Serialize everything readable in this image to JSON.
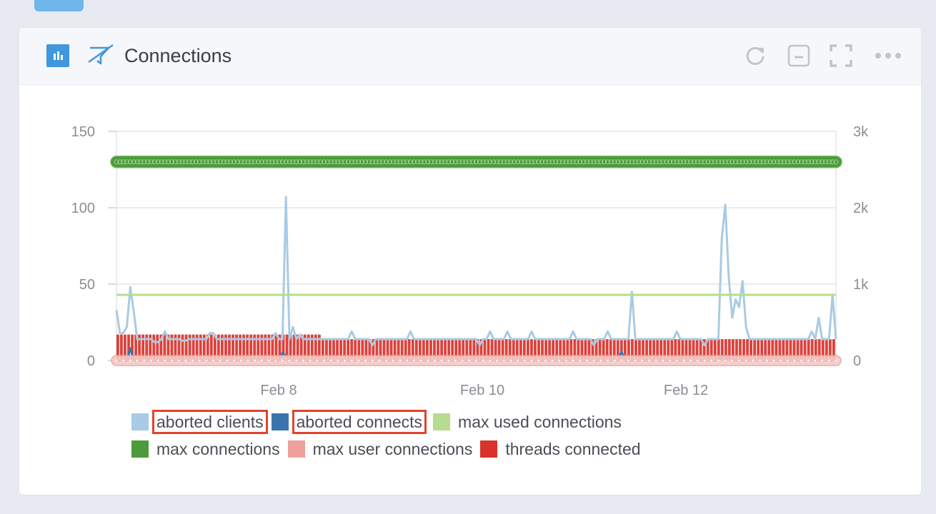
{
  "panel": {
    "title": "Connections",
    "icons": {
      "panel_type": "bar-chart-icon",
      "link": "unlink-icon",
      "refresh": "refresh-icon",
      "collapse": "minimize-icon",
      "fullscreen": "fullscreen-icon",
      "more": "more-options-icon"
    }
  },
  "chart_data": {
    "type": "line",
    "title": "Connections",
    "xlabel": "",
    "ylabel_left": "",
    "ylabel_right": "",
    "x_ticks": [
      "Feb 8",
      "Feb 10",
      "Feb 12"
    ],
    "y_left": {
      "range": [
        0,
        150
      ],
      "ticks": [
        "0",
        "50",
        "100",
        "150"
      ]
    },
    "y_right": {
      "range": [
        0,
        3000
      ],
      "ticks": [
        "0",
        "1k",
        "2k",
        "3k"
      ]
    },
    "grid": true,
    "legend_position": "bottom",
    "x_range_days": [
      "Feb 7 ~03:00",
      "Feb 13 ~13:00"
    ],
    "series": [
      {
        "name": "aborted clients",
        "type": "line",
        "axis": "left",
        "color": "#a9cbe3",
        "values": [
          33,
          18,
          18,
          22,
          48,
          32,
          14,
          14,
          14,
          14,
          14,
          12,
          12,
          14,
          19,
          14,
          14,
          14,
          14,
          13,
          13,
          14,
          14,
          14,
          14,
          14,
          14,
          18,
          18,
          14,
          14,
          14,
          14,
          14,
          14,
          14,
          14,
          14,
          14,
          14,
          14,
          14,
          14,
          14,
          14,
          14,
          18,
          14,
          14,
          107,
          14,
          22,
          14,
          17,
          14,
          14,
          14,
          14,
          14,
          14,
          14,
          14,
          14,
          14,
          14,
          14,
          14,
          14,
          19,
          14,
          14,
          14,
          14,
          14,
          10,
          14,
          14,
          14,
          14,
          14,
          14,
          14,
          14,
          14,
          14,
          19,
          14,
          14,
          14,
          14,
          14,
          14,
          14,
          14,
          14,
          14,
          14,
          14,
          14,
          14,
          14,
          14,
          14,
          14,
          14,
          10,
          14,
          14,
          19,
          14,
          14,
          14,
          14,
          19,
          14,
          14,
          14,
          14,
          14,
          14,
          19,
          14,
          14,
          14,
          14,
          14,
          14,
          14,
          14,
          14,
          14,
          14,
          19,
          14,
          14,
          14,
          14,
          14,
          10,
          14,
          14,
          14,
          19,
          14,
          14,
          14,
          14,
          14,
          14,
          45,
          14,
          14,
          14,
          14,
          14,
          14,
          14,
          14,
          14,
          14,
          14,
          14,
          19,
          14,
          14,
          14,
          14,
          14,
          14,
          14,
          10,
          14,
          14,
          14,
          14,
          80,
          102,
          55,
          28,
          40,
          35,
          52,
          22,
          14,
          14,
          14,
          14,
          14,
          14,
          14,
          14,
          14,
          14,
          14,
          14,
          14,
          14,
          14,
          14,
          14,
          14,
          19,
          14,
          28,
          14,
          14,
          14,
          43,
          14
        ]
      },
      {
        "name": "aborted connects",
        "type": "line",
        "axis": "left",
        "color": "#3a74ae",
        "values": [
          0,
          0,
          0,
          0,
          8,
          0,
          0,
          0,
          0,
          0,
          0,
          0,
          0,
          0,
          0,
          0,
          0,
          0,
          0,
          0,
          0,
          0,
          0,
          0,
          0,
          0,
          0,
          0,
          0,
          0,
          0,
          0,
          0,
          0,
          0,
          0,
          0,
          0,
          0,
          0,
          0,
          1,
          0,
          0,
          0,
          0,
          0,
          0,
          5,
          3,
          0,
          0,
          0,
          0,
          0,
          0,
          0,
          0,
          0,
          0,
          0,
          0,
          0,
          0,
          0,
          0,
          0,
          0,
          0,
          0,
          0,
          0,
          0,
          0,
          0,
          0,
          2,
          0,
          0,
          0,
          0,
          0,
          0,
          0,
          0,
          0,
          0,
          0,
          0,
          0,
          0,
          0,
          0,
          0,
          0,
          0,
          0,
          0,
          0,
          0,
          0,
          0,
          0,
          0,
          0,
          0,
          0,
          1,
          0,
          0,
          0,
          0,
          0,
          0,
          0,
          0,
          0,
          0,
          0,
          0,
          0,
          0,
          0,
          0,
          0,
          0,
          0,
          0,
          0,
          0,
          0,
          0,
          0,
          0,
          0,
          0,
          0,
          0,
          0,
          0,
          0,
          0,
          0,
          0,
          0,
          0,
          6,
          0,
          0,
          0,
          0,
          0,
          0,
          0,
          0,
          0,
          0,
          0,
          0,
          0,
          0,
          0,
          0,
          0,
          0,
          0,
          0,
          0,
          0,
          0,
          0,
          0,
          0,
          0,
          0,
          2,
          0,
          2,
          0,
          0,
          0,
          0,
          0,
          0,
          0,
          0,
          0,
          0,
          0,
          0,
          0,
          0,
          0,
          0,
          0,
          0,
          0,
          0,
          0,
          0,
          0,
          0,
          0,
          0,
          0,
          0,
          0,
          0
        ]
      },
      {
        "name": "max used connections",
        "type": "line",
        "axis": "left",
        "color": "#b6dc8e",
        "values_constant": 43
      },
      {
        "name": "max connections",
        "type": "line-markers",
        "axis": "right",
        "color": "#4b9a3b",
        "values_constant": 2600
      },
      {
        "name": "max user connections",
        "type": "line-markers",
        "axis": "right",
        "color": "#f0a09b",
        "values_constant": 0
      },
      {
        "name": "threads connected",
        "type": "bar",
        "axis": "left",
        "color": "#d8322b",
        "values_summary": {
          "first_quarter": 17,
          "remainder": 14
        },
        "count": 200
      }
    ]
  },
  "legend": [
    {
      "label": "aborted clients",
      "color": "#a9cbe3",
      "highlighted": true
    },
    {
      "label": "aborted connects",
      "color": "#3a74ae",
      "highlighted": true
    },
    {
      "label": "max used connections",
      "color": "#b6dc8e",
      "highlighted": false
    },
    {
      "label": "max connections",
      "color": "#4b9a3b",
      "highlighted": false
    },
    {
      "label": "max user connections",
      "color": "#f0a09b",
      "highlighted": false
    },
    {
      "label": "threads connected",
      "color": "#d8322b",
      "highlighted": false
    }
  ]
}
